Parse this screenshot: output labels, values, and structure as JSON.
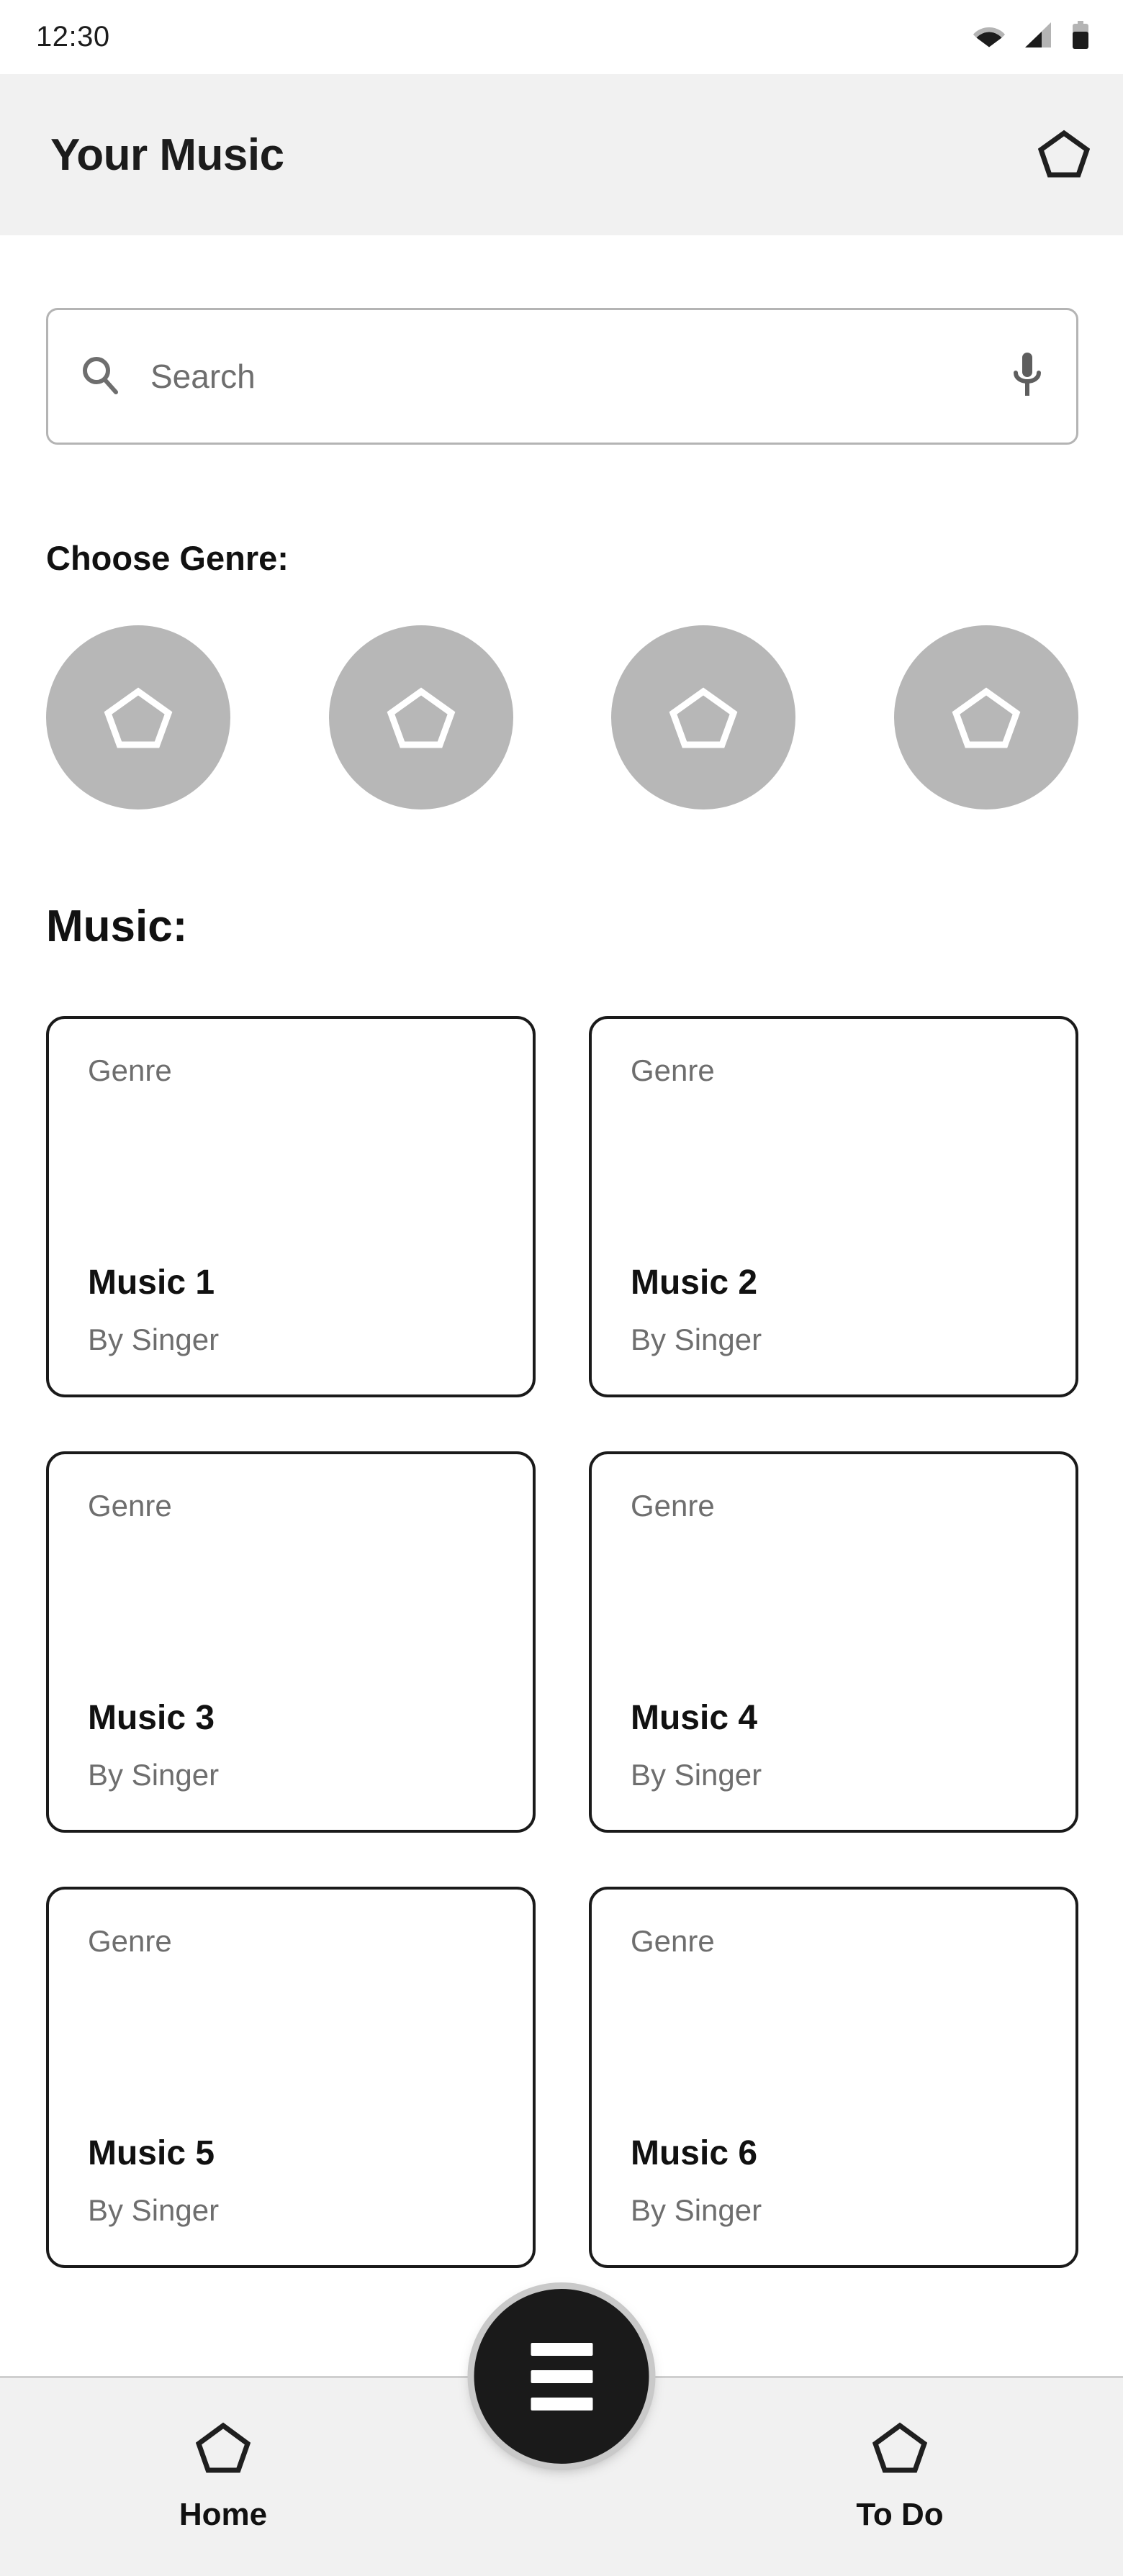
{
  "status_bar": {
    "time": "12:30",
    "icons": [
      "wifi-icon",
      "cellular-signal-icon",
      "battery-icon"
    ]
  },
  "app_bar": {
    "title": "Your Music",
    "action_icon": "pentagon-icon"
  },
  "search": {
    "placeholder": "Search",
    "leading_icon": "search-icon",
    "trailing_icon": "microphone-icon",
    "value": ""
  },
  "genre_section": {
    "title": "Choose Genre:",
    "circles": [
      {
        "icon": "pentagon-icon"
      },
      {
        "icon": "pentagon-icon"
      },
      {
        "icon": "pentagon-icon"
      },
      {
        "icon": "pentagon-icon"
      }
    ]
  },
  "music_section": {
    "title": "Music:",
    "cards": [
      {
        "genre": "Genre",
        "title": "Music 1",
        "artist": "By Singer"
      },
      {
        "genre": "Genre",
        "title": "Music 2",
        "artist": "By Singer"
      },
      {
        "genre": "Genre",
        "title": "Music 3",
        "artist": "By Singer"
      },
      {
        "genre": "Genre",
        "title": "Music 4",
        "artist": "By Singer"
      },
      {
        "genre": "Genre",
        "title": "Music 5",
        "artist": "By Singer"
      },
      {
        "genre": "Genre",
        "title": "Music 6",
        "artist": "By Singer"
      }
    ]
  },
  "bottom_nav": {
    "items": [
      {
        "label": "Home",
        "icon": "pentagon-icon"
      },
      {
        "label": "To Do",
        "icon": "pentagon-icon"
      }
    ],
    "fab": {
      "icon": "hamburger-menu-icon"
    }
  },
  "colors": {
    "app_bar_bg": "#f1f1f1",
    "page_bg": "#ffffff",
    "genre_circle": "#b7b7b7",
    "card_border": "#1a1a1a",
    "muted_text": "#6e6e6e",
    "primary_text": "#111111",
    "fab_bg": "#1a1a1a"
  }
}
